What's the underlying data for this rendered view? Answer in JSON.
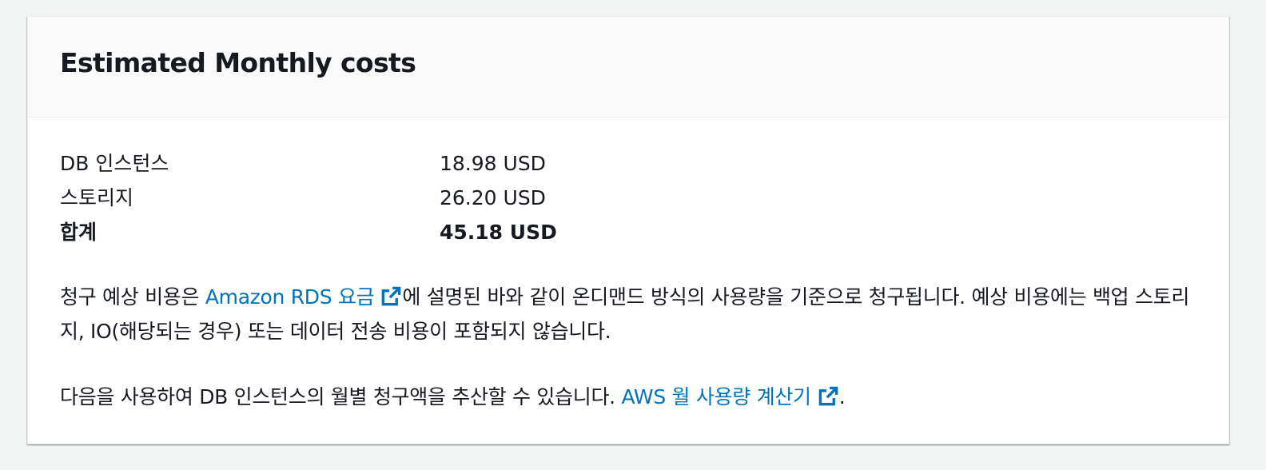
{
  "panel": {
    "title": "Estimated Monthly costs"
  },
  "costs": {
    "rows": [
      {
        "label": "DB 인스턴스",
        "value": "18.98 USD"
      },
      {
        "label": "스토리지",
        "value": "26.20 USD"
      }
    ],
    "total": {
      "label": "합계",
      "value": "45.18 USD"
    }
  },
  "description": {
    "part1_prefix": "청구 예상 비용은 ",
    "pricing_link": "Amazon RDS 요금",
    "part1_suffix": "에 설명된 바와 같이 온디맨드 방식의 사용량을 기준으로 청구됩니다. 예상 비용에는 백업 스토리지, IO(해당되는 경우) 또는 데이터 전송 비용이 포함되지 않습니다.",
    "part2_prefix": "다음을 사용하여 DB 인스턴스의 월별 청구액을 추산할 수 있습니다. ",
    "calculator_link": "AWS 월 사용량 계산기",
    "part2_suffix": "."
  },
  "icons": {
    "external_link": "external-link-icon"
  },
  "colors": {
    "link": "#0073bb",
    "text": "#16191f",
    "header_bg": "#fafafa",
    "page_bg": "#f2f3f3"
  }
}
